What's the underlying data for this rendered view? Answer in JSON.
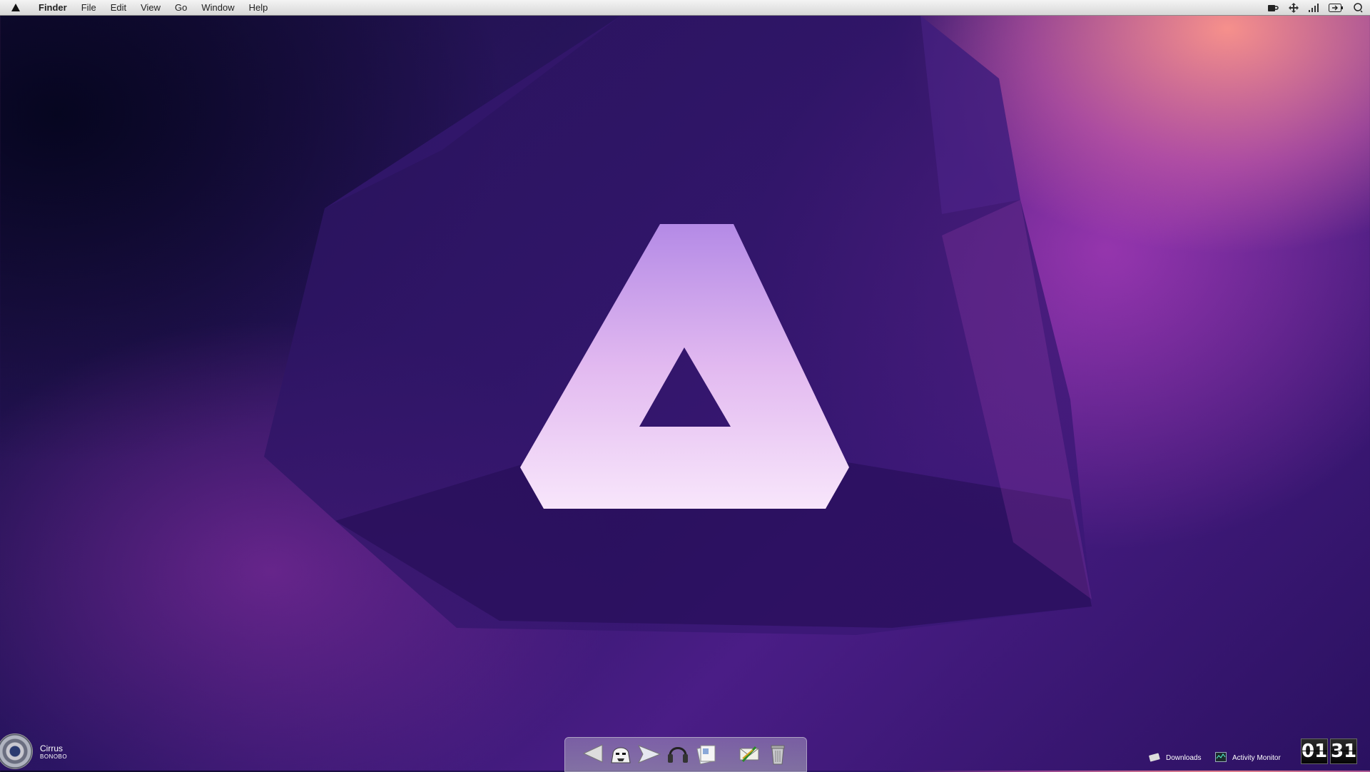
{
  "menubar": {
    "app_name": "Finder",
    "menus": [
      "File",
      "Edit",
      "View",
      "Go",
      "Window",
      "Help"
    ],
    "status_icons": [
      "coffee-cup-icon",
      "move-arrows-icon",
      "signal-bars-icon",
      "battery-icon",
      "spotlight-search-icon"
    ]
  },
  "desktop": {
    "wallpaper_logo": "impossible-triangle-logo",
    "colors": {
      "logo_fill_top": "#b48ae6",
      "logo_fill_bottom": "#f8e6fb",
      "menubar_bg": "#e6e6e6"
    }
  },
  "now_playing": {
    "track": "Cirrus",
    "artist": "BONOBO"
  },
  "dock": {
    "items": [
      "back-arrow-icon",
      "stormtrooper-icon",
      "send-arrow-icon",
      "headphones-icon",
      "documents-icon",
      "mail-stamp-icon",
      "trash-can-icon"
    ]
  },
  "shortcuts": [
    {
      "label": "Downloads",
      "icon": "download-icon"
    },
    {
      "label": "Activity Monitor",
      "icon": "activity-monitor-icon"
    }
  ],
  "clock": {
    "hours": "01",
    "minutes": "31"
  }
}
